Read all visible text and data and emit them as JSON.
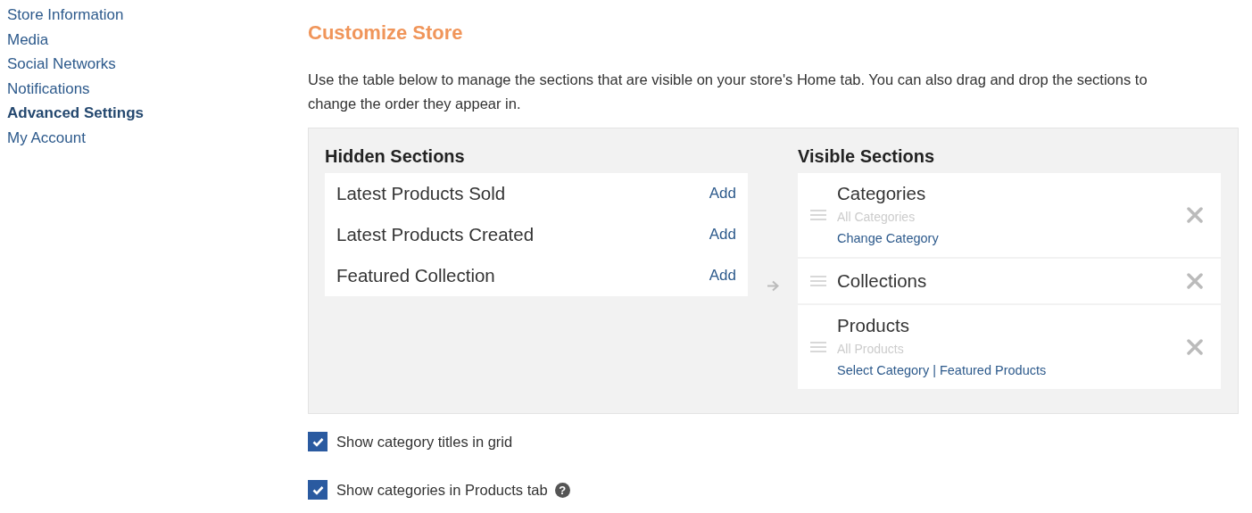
{
  "sidebar": {
    "items": [
      {
        "label": "Store Information",
        "selected": false
      },
      {
        "label": "Media",
        "selected": false
      },
      {
        "label": "Social Networks",
        "selected": false
      },
      {
        "label": "Notifications",
        "selected": false
      },
      {
        "label": "Advanced Settings",
        "selected": true
      },
      {
        "label": "My Account",
        "selected": false
      }
    ]
  },
  "main": {
    "title": "Customize Store",
    "description": "Use the table below to manage the sections that are visible on your store's Home tab. You can also drag and drop the sections to change the order they appear in.",
    "hidden_sections": {
      "heading": "Hidden Sections",
      "items": [
        {
          "label": "Latest Products Sold",
          "action": "Add"
        },
        {
          "label": "Latest Products Created",
          "action": "Add"
        },
        {
          "label": "Featured Collection",
          "action": "Add"
        }
      ]
    },
    "visible_sections": {
      "heading": "Visible Sections",
      "items": [
        {
          "label": "Categories",
          "subtitle": "All Categories",
          "links": [
            "Change Category"
          ]
        },
        {
          "label": "Collections"
        },
        {
          "label": "Products",
          "subtitle": "All Products",
          "links": [
            "Select Category",
            "Featured Products"
          ],
          "separator": "|"
        }
      ]
    },
    "options": [
      {
        "label": "Show category titles in grid",
        "checked": true
      },
      {
        "label": "Show categories in Products tab",
        "checked": true,
        "help": "?"
      }
    ]
  }
}
